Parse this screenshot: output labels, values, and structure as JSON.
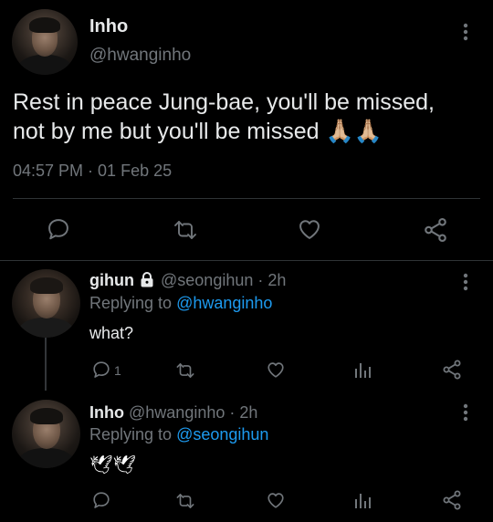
{
  "main_tweet": {
    "display_name": "Inho",
    "handle": "@hwanginho",
    "text": "Rest in peace Jung-bae, you'll be missed, not by me but you'll be missed",
    "emoji": "🙏🏼🙏🏼",
    "time": "04:57 PM",
    "date_sep": " · ",
    "date": "01 Feb 25"
  },
  "replies": [
    {
      "display_name": "gihun",
      "handle": "@seongihun",
      "time": " · 2h",
      "replying_prefix": "Replying to ",
      "replying_to": "@hwanginho",
      "text": "what?",
      "reply_count": "1"
    },
    {
      "display_name": "Inho",
      "handle": "@hwanginho",
      "time": " · 2h",
      "replying_prefix": "Replying to ",
      "replying_to": "@seongihun",
      "text": "🕊🕊"
    }
  ],
  "colors": {
    "background": "#000000",
    "text": "#e7e9ea",
    "muted": "#71767b",
    "link": "#1d9bf0",
    "divider": "#2f3336"
  }
}
